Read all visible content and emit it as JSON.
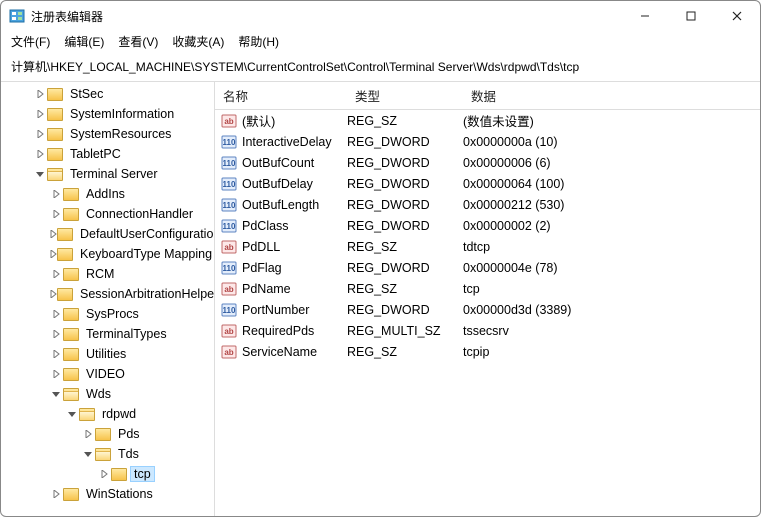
{
  "window_title": "注册表编辑器",
  "menu": [
    "文件(F)",
    "编辑(E)",
    "查看(V)",
    "收藏夹(A)",
    "帮助(H)"
  ],
  "address": "计算机\\HKEY_LOCAL_MACHINE\\SYSTEM\\CurrentControlSet\\Control\\Terminal Server\\Wds\\rdpwd\\Tds\\tcp",
  "columns": {
    "name": "名称",
    "type": "类型",
    "data": "数据"
  },
  "tree": [
    {
      "label": "StSec",
      "depth": 3,
      "leaf": true
    },
    {
      "label": "SystemInformation",
      "depth": 3,
      "leaf": true
    },
    {
      "label": "SystemResources",
      "depth": 3,
      "leaf": true
    },
    {
      "label": "TabletPC",
      "depth": 3,
      "leaf": true
    },
    {
      "label": "Terminal Server",
      "depth": 3,
      "open": true
    },
    {
      "label": "AddIns",
      "depth": 4,
      "leaf": true
    },
    {
      "label": "ConnectionHandler",
      "depth": 4,
      "leaf": true
    },
    {
      "label": "DefaultUserConfiguration",
      "depth": 4,
      "leaf": true
    },
    {
      "label": "KeyboardType Mapping",
      "depth": 4,
      "leaf": true
    },
    {
      "label": "RCM",
      "depth": 4,
      "leaf": true
    },
    {
      "label": "SessionArbitrationHelper",
      "depth": 4,
      "leaf": true
    },
    {
      "label": "SysProcs",
      "depth": 4,
      "leaf": true
    },
    {
      "label": "TerminalTypes",
      "depth": 4,
      "leaf": true
    },
    {
      "label": "Utilities",
      "depth": 4,
      "leaf": true
    },
    {
      "label": "VIDEO",
      "depth": 4,
      "leaf": true
    },
    {
      "label": "Wds",
      "depth": 4,
      "open": true
    },
    {
      "label": "rdpwd",
      "depth": 5,
      "open": true
    },
    {
      "label": "Pds",
      "depth": 6,
      "leaf": true
    },
    {
      "label": "Tds",
      "depth": 6,
      "open": true
    },
    {
      "label": "tcp",
      "depth": 7,
      "leaf": true,
      "selected": true
    },
    {
      "label": "WinStations",
      "depth": 4,
      "leaf": true
    }
  ],
  "values": [
    {
      "name": "(默认)",
      "type": "REG_SZ",
      "data": "(数值未设置)",
      "icon": "str"
    },
    {
      "name": "InteractiveDelay",
      "type": "REG_DWORD",
      "data": "0x0000000a (10)",
      "icon": "bin"
    },
    {
      "name": "OutBufCount",
      "type": "REG_DWORD",
      "data": "0x00000006 (6)",
      "icon": "bin"
    },
    {
      "name": "OutBufDelay",
      "type": "REG_DWORD",
      "data": "0x00000064 (100)",
      "icon": "bin"
    },
    {
      "name": "OutBufLength",
      "type": "REG_DWORD",
      "data": "0x00000212 (530)",
      "icon": "bin"
    },
    {
      "name": "PdClass",
      "type": "REG_DWORD",
      "data": "0x00000002 (2)",
      "icon": "bin"
    },
    {
      "name": "PdDLL",
      "type": "REG_SZ",
      "data": "tdtcp",
      "icon": "str"
    },
    {
      "name": "PdFlag",
      "type": "REG_DWORD",
      "data": "0x0000004e (78)",
      "icon": "bin"
    },
    {
      "name": "PdName",
      "type": "REG_SZ",
      "data": "tcp",
      "icon": "str"
    },
    {
      "name": "PortNumber",
      "type": "REG_DWORD",
      "data": "0x00000d3d (3389)",
      "icon": "bin"
    },
    {
      "name": "RequiredPds",
      "type": "REG_MULTI_SZ",
      "data": "tssecsrv",
      "icon": "str"
    },
    {
      "name": "ServiceName",
      "type": "REG_SZ",
      "data": "tcpip",
      "icon": "str"
    }
  ]
}
